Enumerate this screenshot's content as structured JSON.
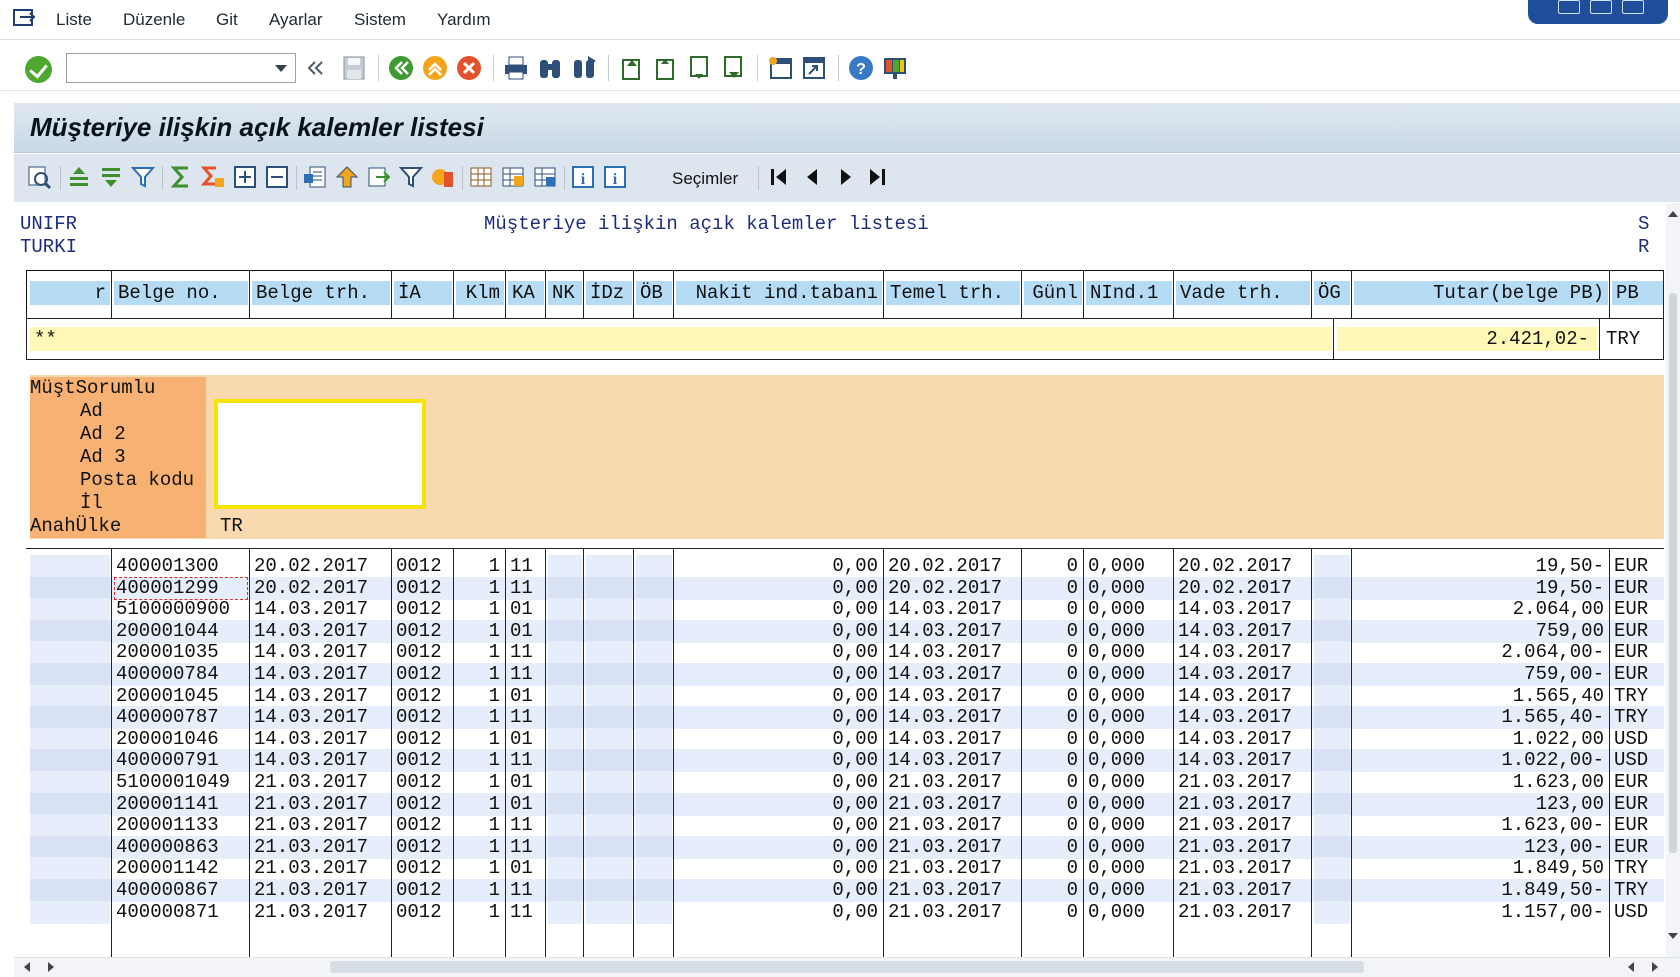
{
  "menubar": {
    "items": [
      "Liste",
      "Düzenle",
      "Git",
      "Ayarlar",
      "Sistem",
      "Yardım"
    ]
  },
  "toolbar": {
    "command_value": "",
    "icons": [
      "enter-icon",
      "save-icon",
      "back-icon",
      "exit-icon",
      "cancel-icon",
      "print-icon",
      "find-icon",
      "find-next-icon",
      "first-page-icon",
      "previous-page-icon",
      "next-page-icon",
      "last-page-icon",
      "create-session-icon",
      "shortcut-icon",
      "help-icon",
      "customize-layout-icon"
    ]
  },
  "title": "Müşteriye ilişkin açık kalemler listesi",
  "app_toolbar": {
    "selections_label": "Seçimler"
  },
  "report": {
    "header_left": [
      "UNIFR",
      "TURKI"
    ],
    "header_center": "Müşteriye ilişkin açık kalemler listesi",
    "header_right": [
      "S",
      "R"
    ],
    "columns": [
      "r",
      "Belge no.",
      "Belge trh.",
      "İA",
      "Klm",
      "KA",
      "NK",
      "İDz",
      "ÖB",
      "Nakit ind.tabanı",
      "Temel trh.",
      "Günl",
      "NInd.1",
      "Vade trh.",
      "ÖG",
      "Tutar(belge PB)",
      "PB"
    ],
    "sum_row": {
      "marker": "**",
      "amount": "2.421,02-",
      "currency": "TRY"
    },
    "customer": {
      "labels": [
        "MüştSorumlu",
        "Ad",
        "Ad 2",
        "Ad 3",
        "Posta kodu",
        "İl",
        "AnahÜlke"
      ],
      "country": "TR"
    },
    "rows": [
      [
        "400001300",
        "20.02.2017",
        "0012",
        "1",
        "11",
        "0,00",
        "20.02.2017",
        "0",
        "0,000",
        "20.02.2017",
        "19,50-",
        "EUR"
      ],
      [
        "400001299",
        "20.02.2017",
        "0012",
        "1",
        "11",
        "0,00",
        "20.02.2017",
        "0",
        "0,000",
        "20.02.2017",
        "19,50-",
        "EUR"
      ],
      [
        "5100000900",
        "14.03.2017",
        "0012",
        "1",
        "01",
        "0,00",
        "14.03.2017",
        "0",
        "0,000",
        "14.03.2017",
        "2.064,00",
        "EUR"
      ],
      [
        "200001044",
        "14.03.2017",
        "0012",
        "1",
        "01",
        "0,00",
        "14.03.2017",
        "0",
        "0,000",
        "14.03.2017",
        "759,00",
        "EUR"
      ],
      [
        "200001035",
        "14.03.2017",
        "0012",
        "1",
        "11",
        "0,00",
        "14.03.2017",
        "0",
        "0,000",
        "14.03.2017",
        "2.064,00-",
        "EUR"
      ],
      [
        "400000784",
        "14.03.2017",
        "0012",
        "1",
        "11",
        "0,00",
        "14.03.2017",
        "0",
        "0,000",
        "14.03.2017",
        "759,00-",
        "EUR"
      ],
      [
        "200001045",
        "14.03.2017",
        "0012",
        "1",
        "01",
        "0,00",
        "14.03.2017",
        "0",
        "0,000",
        "14.03.2017",
        "1.565,40",
        "TRY"
      ],
      [
        "400000787",
        "14.03.2017",
        "0012",
        "1",
        "11",
        "0,00",
        "14.03.2017",
        "0",
        "0,000",
        "14.03.2017",
        "1.565,40-",
        "TRY"
      ],
      [
        "200001046",
        "14.03.2017",
        "0012",
        "1",
        "01",
        "0,00",
        "14.03.2017",
        "0",
        "0,000",
        "14.03.2017",
        "1.022,00",
        "USD"
      ],
      [
        "400000791",
        "14.03.2017",
        "0012",
        "1",
        "11",
        "0,00",
        "14.03.2017",
        "0",
        "0,000",
        "14.03.2017",
        "1.022,00-",
        "USD"
      ],
      [
        "5100001049",
        "21.03.2017",
        "0012",
        "1",
        "01",
        "0,00",
        "21.03.2017",
        "0",
        "0,000",
        "21.03.2017",
        "1.623,00",
        "EUR"
      ],
      [
        "200001141",
        "21.03.2017",
        "0012",
        "1",
        "01",
        "0,00",
        "21.03.2017",
        "0",
        "0,000",
        "21.03.2017",
        "123,00",
        "EUR"
      ],
      [
        "200001133",
        "21.03.2017",
        "0012",
        "1",
        "11",
        "0,00",
        "21.03.2017",
        "0",
        "0,000",
        "21.03.2017",
        "1.623,00-",
        "EUR"
      ],
      [
        "400000863",
        "21.03.2017",
        "0012",
        "1",
        "11",
        "0,00",
        "21.03.2017",
        "0",
        "0,000",
        "21.03.2017",
        "123,00-",
        "EUR"
      ],
      [
        "200001142",
        "21.03.2017",
        "0012",
        "1",
        "01",
        "0,00",
        "21.03.2017",
        "0",
        "0,000",
        "21.03.2017",
        "1.849,50",
        "TRY"
      ],
      [
        "400000867",
        "21.03.2017",
        "0012",
        "1",
        "11",
        "0,00",
        "21.03.2017",
        "0",
        "0,000",
        "21.03.2017",
        "1.849,50-",
        "TRY"
      ],
      [
        "400000871",
        "21.03.2017",
        "0012",
        "1",
        "11",
        "0,00",
        "21.03.2017",
        "0",
        "0,000",
        "21.03.2017",
        "1.157,00-",
        "USD"
      ]
    ]
  }
}
